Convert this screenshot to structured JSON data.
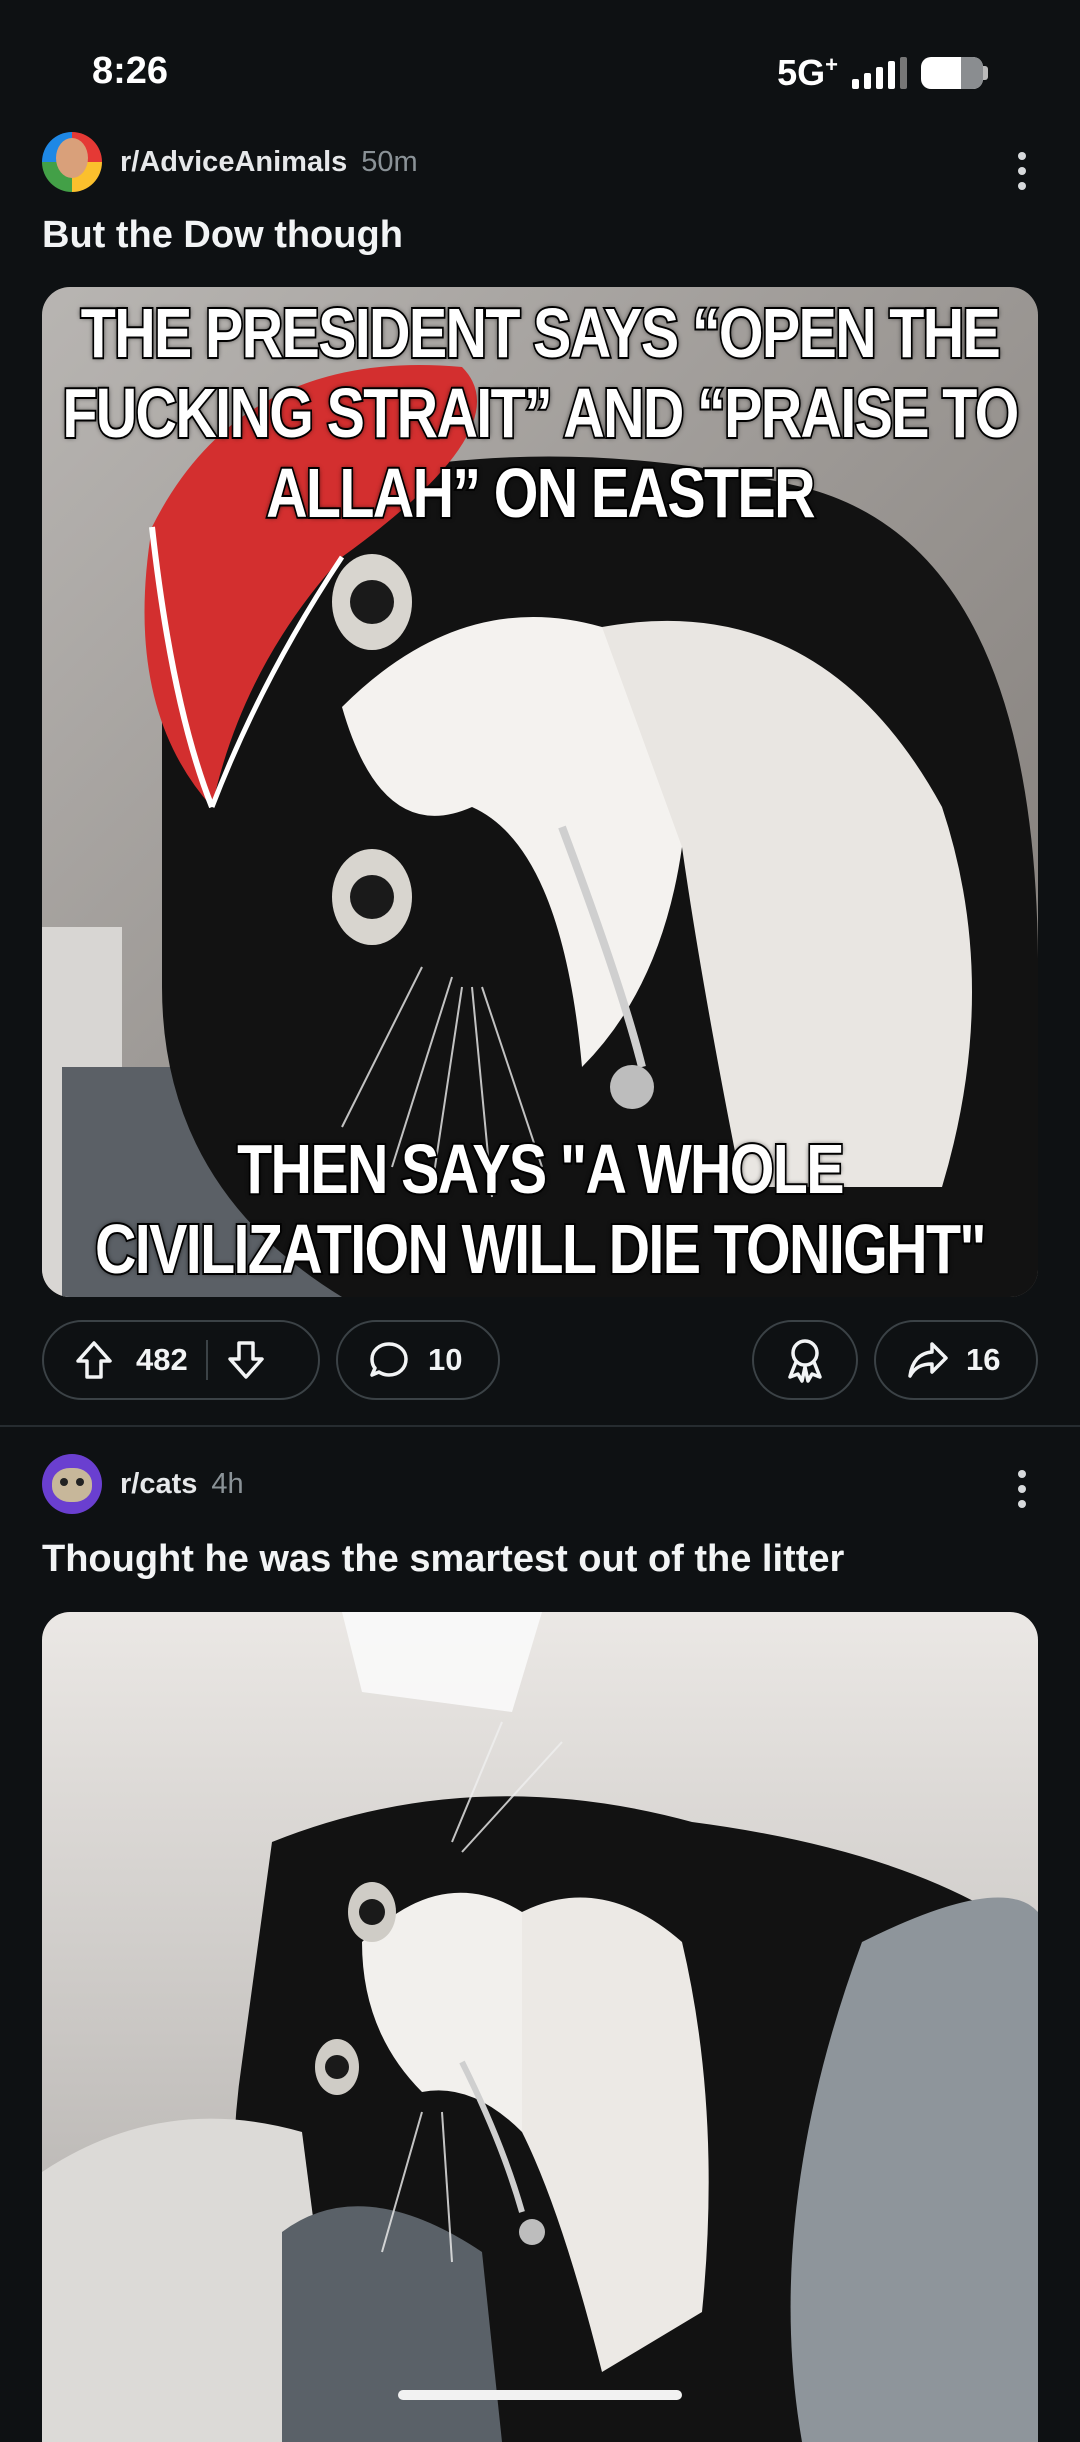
{
  "status_bar": {
    "time": "8:26",
    "network": "5G",
    "network_sup": "+"
  },
  "posts": [
    {
      "subreddit": "r/AdviceAnimals",
      "age": "50m",
      "title": "But the Dow though",
      "meme_top": "THE PRESIDENT SAYS “OPEN THE FUCKING STRAIT” AND “PRAISE TO ALLAH” ON EASTER",
      "meme_bottom": "THEN SAYS \"A WHOLE CIVILIZATION WILL DIE TONIGHT\"",
      "upvotes": "482",
      "comments": "10",
      "shares": "16"
    },
    {
      "subreddit": "r/cats",
      "age": "4h",
      "title": "Thought he was the smartest out of the litter"
    }
  ],
  "colors": {
    "background": "#0e1113",
    "pill_border": "#3b4246",
    "muted_text": "#8a9297"
  },
  "icons": [
    "upvote-icon",
    "downvote-icon",
    "comment-icon",
    "award-icon",
    "share-icon",
    "more-icon"
  ]
}
